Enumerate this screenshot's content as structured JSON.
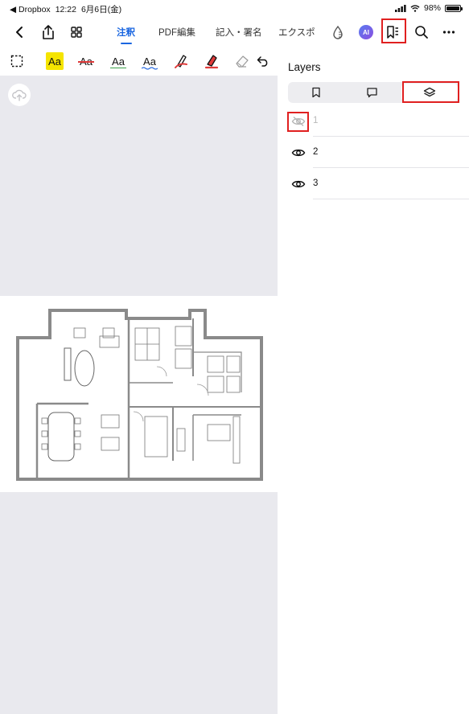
{
  "status_bar": {
    "back_app": "◀ Dropbox",
    "time": "12:22",
    "date": "6月6日(金)",
    "battery": "98%",
    "battery_level": 0.98
  },
  "nav": {
    "tabs": [
      {
        "label": "注釈",
        "active": true
      },
      {
        "label": "PDF編集",
        "active": false
      },
      {
        "label": "記入・署名",
        "active": false
      },
      {
        "label": "エクスポ",
        "active": false
      }
    ],
    "ai_label": "AI",
    "icons": [
      "back-icon",
      "share-icon",
      "grid-icon",
      "ink-drop-icon",
      "ai-icon",
      "bookmark-panel-icon",
      "search-icon",
      "more-icon"
    ]
  },
  "toolbar": {
    "tools": [
      {
        "name": "select-tool",
        "label": ""
      },
      {
        "name": "highlight-tool",
        "label": "Aa"
      },
      {
        "name": "strikethrough-tool",
        "label": "Aa"
      },
      {
        "name": "underline-tool",
        "label": "Aa"
      },
      {
        "name": "squiggly-tool",
        "label": "Aa"
      },
      {
        "name": "pen-tool",
        "label": ""
      },
      {
        "name": "highlighter-tool",
        "label": ""
      },
      {
        "name": "eraser-tool",
        "label": ""
      },
      {
        "name": "undo-tool",
        "label": ""
      }
    ],
    "colors": {
      "highlight": "#f5e400",
      "red": "#e03a3a",
      "green": "#3aa04a",
      "blue": "#2d6de0"
    }
  },
  "panel": {
    "title": "Layers",
    "segments": [
      "bookmark-icon",
      "comment-icon",
      "layers-icon"
    ],
    "selected_segment": 2,
    "layers": [
      {
        "label": "1",
        "visible": false
      },
      {
        "label": "2",
        "visible": true
      },
      {
        "label": "3",
        "visible": true
      }
    ]
  },
  "colors": {
    "accent": "#1a66e0",
    "highlight_box": "#e02020",
    "canvas_bg": "#e9e9ee"
  }
}
